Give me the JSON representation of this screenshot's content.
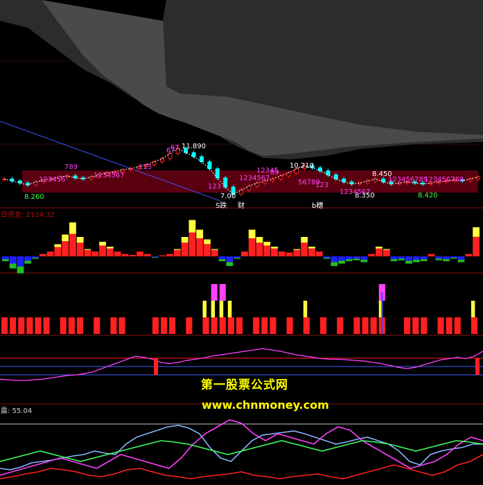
{
  "colors": {
    "background": "#000000",
    "bull": "#ff2020",
    "bear": "#00ffff",
    "yellow": "#ffff40",
    "magenta": "#ff40ff",
    "blue": "#4040ff",
    "green": "#40ff40",
    "zone": "#5a0010",
    "cloud": "#303030"
  },
  "watermark": {
    "line1": "第一股票公式网",
    "line2": "www.chnmoney.com"
  },
  "chart_data": [
    {
      "type": "candlestick",
      "panel": "price",
      "price_labels": [
        "8.260",
        "11.890",
        "10.210",
        "8.450",
        "8.350",
        "8.420",
        "7.00"
      ],
      "tag_labels": [
        "123456",
        "789",
        "67",
        "123",
        "1234567",
        "89",
        "123456789",
        "123",
        "1234567",
        "12345",
        "56789",
        "123456789",
        "1234567",
        "67",
        "123"
      ],
      "signal_labels": [
        "S跌",
        "财",
        "b穗"
      ],
      "closes": [
        8.9,
        8.7,
        8.5,
        8.3,
        8.6,
        8.8,
        8.9,
        9.1,
        9.2,
        9.0,
        8.9,
        9.1,
        9.3,
        9.5,
        9.6,
        9.8,
        9.9,
        10.1,
        10.3,
        10.6,
        10.9,
        11.4,
        11.9,
        11.5,
        11.1,
        10.6,
        9.9,
        9.0,
        8.1,
        7.4,
        7.8,
        8.2,
        8.5,
        8.7,
        8.9,
        9.2,
        9.5,
        9.9,
        10.2,
        10.0,
        9.7,
        9.3,
        8.9,
        8.6,
        8.4,
        8.5,
        8.7,
        8.9,
        8.6,
        8.4,
        8.5,
        8.6,
        8.5,
        8.4,
        8.5,
        8.6,
        8.7,
        8.8,
        8.7,
        8.9,
        9.1
      ]
    },
    {
      "type": "bar",
      "panel": "money_flow",
      "title": "日资金",
      "value_label": "2124.32",
      "values": [
        -10,
        -25,
        -35,
        -15,
        -5,
        5,
        10,
        25,
        45,
        70,
        40,
        15,
        10,
        30,
        20,
        10,
        5,
        3,
        10,
        5,
        -3,
        2,
        5,
        15,
        40,
        75,
        55,
        35,
        15,
        -10,
        -20,
        -5,
        10,
        55,
        40,
        30,
        20,
        10,
        8,
        15,
        40,
        20,
        10,
        -5,
        -20,
        -15,
        -10,
        -8,
        -12,
        5,
        20,
        15,
        -10,
        -8,
        -15,
        -12,
        -10,
        5,
        -8,
        -10,
        -5,
        -12,
        5,
        60
      ]
    },
    {
      "type": "bar",
      "panel": "signals",
      "values": [
        1,
        1,
        1,
        1,
        1,
        1,
        0,
        1,
        1,
        1,
        0,
        1,
        0,
        1,
        1,
        0,
        0,
        0,
        1,
        1,
        1,
        0,
        1,
        0,
        2,
        3,
        3,
        2,
        1,
        0,
        1,
        1,
        1,
        0,
        1,
        0,
        2,
        0,
        1,
        0,
        1,
        0,
        1,
        1,
        1,
        4,
        0,
        0,
        1,
        1,
        1,
        0,
        1,
        1,
        1,
        0,
        2
      ]
    },
    {
      "type": "line",
      "panel": "oscillator",
      "series": [
        {
          "values": [
            3,
            2,
            1,
            1,
            2,
            3,
            5,
            7,
            9,
            10,
            12,
            15,
            20,
            25,
            30,
            35,
            40,
            38,
            35,
            30,
            28,
            30,
            33,
            35,
            37,
            40,
            42,
            44,
            46,
            48,
            50,
            52,
            50,
            48,
            45,
            42,
            40,
            38,
            36,
            35,
            35,
            34,
            33,
            32,
            30,
            28,
            25,
            22,
            20,
            22,
            26,
            30,
            34,
            36,
            38,
            36,
            40,
            48
          ]
        },
        {
          "values": [
            38,
            38,
            38,
            38,
            38,
            38,
            38,
            38,
            38,
            38,
            38,
            38,
            38,
            38,
            38,
            38,
            38,
            38,
            38,
            38,
            38,
            38,
            38,
            38,
            38,
            38,
            38,
            38,
            38,
            38,
            38,
            38,
            38,
            38,
            38,
            38,
            38,
            38,
            38,
            38
          ]
        }
      ]
    },
    {
      "type": "line",
      "panel": "indicator",
      "title": "震",
      "value_label": "55.04",
      "series": [
        {
          "values": [
            20,
            18,
            22,
            28,
            30,
            32,
            35,
            38,
            40,
            45,
            42,
            40,
            55,
            65,
            70,
            75,
            80,
            82,
            78,
            70,
            50,
            35,
            30,
            45,
            60,
            68,
            70,
            72,
            74,
            70,
            65,
            60,
            55,
            58,
            62,
            65,
            60,
            55,
            45,
            30,
            25,
            40,
            45,
            48,
            50,
            55,
            55
          ]
        },
        {
          "values": [
            10,
            15,
            20,
            25,
            30,
            35,
            30,
            25,
            20,
            30,
            40,
            35,
            30,
            25,
            20,
            35,
            55,
            70,
            80,
            90,
            85,
            70,
            60,
            70,
            65,
            60,
            55,
            70,
            80,
            75,
            60,
            50,
            40,
            30,
            20,
            25,
            30,
            40,
            55,
            65,
            60
          ]
        },
        {
          "values": [
            30,
            35,
            40,
            45,
            40,
            35,
            30,
            35,
            40,
            45,
            50,
            55,
            60,
            58,
            55,
            50,
            45,
            40,
            45,
            50,
            55,
            60,
            55,
            50,
            45,
            50,
            55,
            60,
            58,
            55,
            50,
            45,
            50,
            55,
            60,
            58,
            55
          ]
        },
        {
          "values": [
            5,
            8,
            12,
            15,
            20,
            18,
            15,
            10,
            8,
            12,
            18,
            20,
            15,
            10,
            8,
            5,
            8,
            10,
            12,
            15,
            10,
            8,
            5,
            8,
            10,
            12,
            8,
            5,
            10,
            15,
            20,
            25,
            20,
            15,
            10,
            15,
            25,
            30,
            40
          ]
        }
      ]
    }
  ]
}
